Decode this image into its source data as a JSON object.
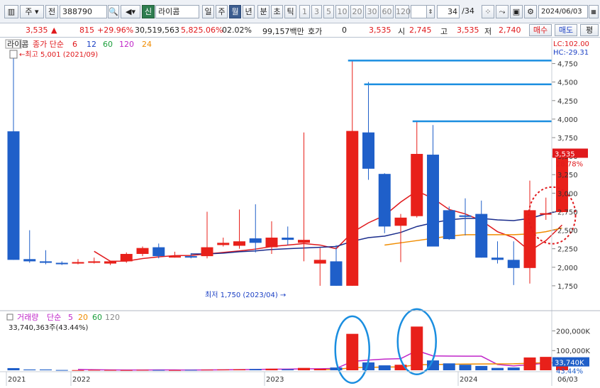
{
  "toolbar": {
    "market_type": "주",
    "market_scope": "전",
    "stock_code": "388790",
    "stock_tag": "신",
    "stock_name": "라이콤",
    "periods": [
      "일",
      "주",
      "월",
      "년"
    ],
    "selected_period": "월",
    "intervals": [
      "분",
      "초",
      "틱"
    ],
    "minute_values": [
      "1",
      "3",
      "5",
      "10",
      "20",
      "30",
      "60",
      "120"
    ],
    "page_counter": "34",
    "page_total": "/34",
    "date": "2024/06/03"
  },
  "quote": {
    "price": "3,535",
    "change": "815",
    "change_pct": "+29.96%",
    "volume": "30,519,563",
    "volume_ratio": "5,825.06%",
    "turnover_rate": "02.02%",
    "amount": "99,157백만",
    "hoga_label": "호가",
    "hoga_value": "0",
    "price2": "3,535",
    "open_label": "시",
    "open": "2,745",
    "high_label": "고",
    "high": "3,535",
    "low_label": "저",
    "low": "2,740",
    "buy_label": "매수",
    "sell_label": "매도",
    "eval_label": "평"
  },
  "price_panel": {
    "name_tag": "라이콤",
    "ma_label": "종가 단순",
    "ma_periods": [
      "6",
      "12",
      "60",
      "120",
      "24"
    ],
    "max_annotation": "최고 5,001 (2021/09)",
    "min_annotation": "최저 1,750 (2023/04)",
    "lc_label": "LC:102.00",
    "hc_label": "HC:-29.31",
    "last_price_tag": "3,535",
    "last_pct_tag": "28.78%"
  },
  "volume_panel": {
    "label": "거래량",
    "ma_label": "단순",
    "ma_periods": [
      "5",
      "20",
      "60",
      "120"
    ],
    "current": "33,740,363주(43.44%)",
    "tag_value": "33,740K",
    "tag_pct": "43.44%"
  },
  "colors": {
    "up": "#e8201a",
    "down": "#1f5fc9",
    "annotation_line": "#1a8ee0"
  },
  "chart_data": {
    "type": "candlestick",
    "period": "monthly",
    "y_ticks": [
      "4,750",
      "4,500",
      "4,250",
      "4,000",
      "3,750",
      "3,500",
      "3,250",
      "3,000",
      "2,750",
      "2,500",
      "2,250",
      "2,000",
      "1,750"
    ],
    "y_tick_values": [
      4750,
      4500,
      4250,
      4000,
      3750,
      3500,
      3250,
      3000,
      2750,
      2500,
      2250,
      2000,
      1750
    ],
    "ylim": [
      1500,
      4880
    ],
    "x_labels": [
      "2021",
      "2022",
      "2023",
      "2024",
      "06/03"
    ],
    "x_label_index": [
      0,
      4,
      16,
      28,
      34
    ],
    "vol_ticks": [
      "200,000K",
      "100,000K"
    ],
    "vol_tick_values": [
      200000,
      100000
    ],
    "vol_max": 245000,
    "candles": [
      {
        "o": 3835,
        "h": 4880,
        "l": 2100,
        "c": 2100
      },
      {
        "o": 2110,
        "h": 2500,
        "l": 2060,
        "c": 2080
      },
      {
        "o": 2080,
        "h": 2230,
        "l": 2040,
        "c": 2060
      },
      {
        "o": 2060,
        "h": 2080,
        "l": 2030,
        "c": 2050
      },
      {
        "o": 2050,
        "h": 2110,
        "l": 2040,
        "c": 2070
      },
      {
        "o": 2060,
        "h": 2130,
        "l": 2050,
        "c": 2080
      },
      {
        "o": 2050,
        "h": 2090,
        "l": 2030,
        "c": 2080
      },
      {
        "o": 2080,
        "h": 2200,
        "l": 2060,
        "c": 2180
      },
      {
        "o": 2180,
        "h": 2280,
        "l": 2150,
        "c": 2260
      },
      {
        "o": 2270,
        "h": 2320,
        "l": 2120,
        "c": 2150
      },
      {
        "o": 2150,
        "h": 2210,
        "l": 2130,
        "c": 2150
      },
      {
        "o": 2150,
        "h": 2190,
        "l": 2120,
        "c": 2140
      },
      {
        "o": 2150,
        "h": 2750,
        "l": 2120,
        "c": 2270
      },
      {
        "o": 2300,
        "h": 2400,
        "l": 2280,
        "c": 2330
      },
      {
        "o": 2290,
        "h": 2780,
        "l": 2250,
        "c": 2350
      },
      {
        "o": 2390,
        "h": 2850,
        "l": 2200,
        "c": 2330
      },
      {
        "o": 2270,
        "h": 2620,
        "l": 2180,
        "c": 2400
      },
      {
        "o": 2400,
        "h": 2550,
        "l": 2300,
        "c": 2370
      },
      {
        "o": 2330,
        "h": 3820,
        "l": 2080,
        "c": 2370
      },
      {
        "o": 2050,
        "h": 2260,
        "l": 1750,
        "c": 2100
      },
      {
        "o": 2080,
        "h": 2300,
        "l": 1750,
        "c": 1750
      },
      {
        "o": 1750,
        "h": 4780,
        "l": 1750,
        "c": 3840
      },
      {
        "o": 3820,
        "h": 4500,
        "l": 3180,
        "c": 3330
      },
      {
        "o": 3260,
        "h": 3270,
        "l": 2460,
        "c": 2550
      },
      {
        "o": 2560,
        "h": 2720,
        "l": 2070,
        "c": 2670
      },
      {
        "o": 2690,
        "h": 3970,
        "l": 2670,
        "c": 3530
      },
      {
        "o": 3520,
        "h": 3920,
        "l": 2280,
        "c": 2280
      },
      {
        "o": 2770,
        "h": 2820,
        "l": 2370,
        "c": 2380
      },
      {
        "o": 2700,
        "h": 2930,
        "l": 2430,
        "c": 2680
      },
      {
        "o": 2720,
        "h": 2900,
        "l": 2130,
        "c": 2130
      },
      {
        "o": 2130,
        "h": 2350,
        "l": 2050,
        "c": 2100
      },
      {
        "o": 2100,
        "h": 2350,
        "l": 1760,
        "c": 1990
      },
      {
        "o": 1990,
        "h": 3170,
        "l": 1780,
        "c": 2770
      },
      {
        "o": 2710,
        "h": 2940,
        "l": 2640,
        "c": 2730
      },
      {
        "o": 2745,
        "h": 3535,
        "l": 2740,
        "c": 3535
      }
    ],
    "volumes": [
      11000,
      4000,
      4000,
      1500,
      1000,
      2000,
      1500,
      1000,
      2000,
      1500,
      1000,
      2000,
      3000,
      4000,
      5000,
      6500,
      8000,
      5000,
      12000,
      7500,
      14000,
      185000,
      40000,
      25000,
      28000,
      222000,
      50000,
      35000,
      28000,
      22000,
      12000,
      14000,
      65000,
      68000,
      33740
    ],
    "ma6": [
      null,
      null,
      null,
      null,
      null,
      2215,
      2082,
      2083,
      2118,
      2140,
      2157,
      2160,
      2180,
      2200,
      2220,
      2245,
      2280,
      2300,
      2320,
      2300,
      2250,
      2470,
      2600,
      2700,
      2880,
      3030,
      2930,
      2780,
      2720,
      2630,
      2480,
      2400,
      2220,
      2360,
      2570
    ],
    "ma12": [
      null,
      null,
      null,
      null,
      null,
      null,
      null,
      null,
      null,
      null,
      null,
      2180,
      2180,
      2190,
      2210,
      2220,
      2240,
      2250,
      2260,
      2270,
      2280,
      2350,
      2400,
      2420,
      2470,
      2550,
      2600,
      2640,
      2660,
      2660,
      2640,
      2630,
      2660,
      2720,
      2770
    ],
    "ma24": [
      null,
      null,
      null,
      null,
      null,
      null,
      null,
      null,
      null,
      null,
      null,
      null,
      null,
      null,
      null,
      null,
      null,
      null,
      null,
      null,
      null,
      null,
      null,
      2300,
      2330,
      2360,
      2390,
      2420,
      2440,
      2440,
      2440,
      2440,
      2450,
      2480,
      2530
    ],
    "vol_ma5": [
      null,
      null,
      null,
      null,
      4300,
      2500,
      1800,
      1500,
      1500,
      1600,
      1600,
      1500,
      1900,
      2300,
      3000,
      4000,
      5300,
      5700,
      7300,
      7800,
      9300,
      44700,
      51700,
      56800,
      59000,
      100000,
      73000,
      72000,
      71800,
      71400,
      29400,
      22200,
      28200,
      36200,
      38548
    ],
    "vol_ma20": [
      null,
      null,
      null,
      null,
      null,
      null,
      null,
      null,
      null,
      null,
      null,
      null,
      null,
      null,
      null,
      null,
      null,
      null,
      null,
      3500,
      4000,
      13000,
      15000,
      16000,
      17000,
      28000,
      29000,
      30500,
      31500,
      32200,
      32500,
      32800,
      35800,
      38700,
      39500
    ]
  }
}
